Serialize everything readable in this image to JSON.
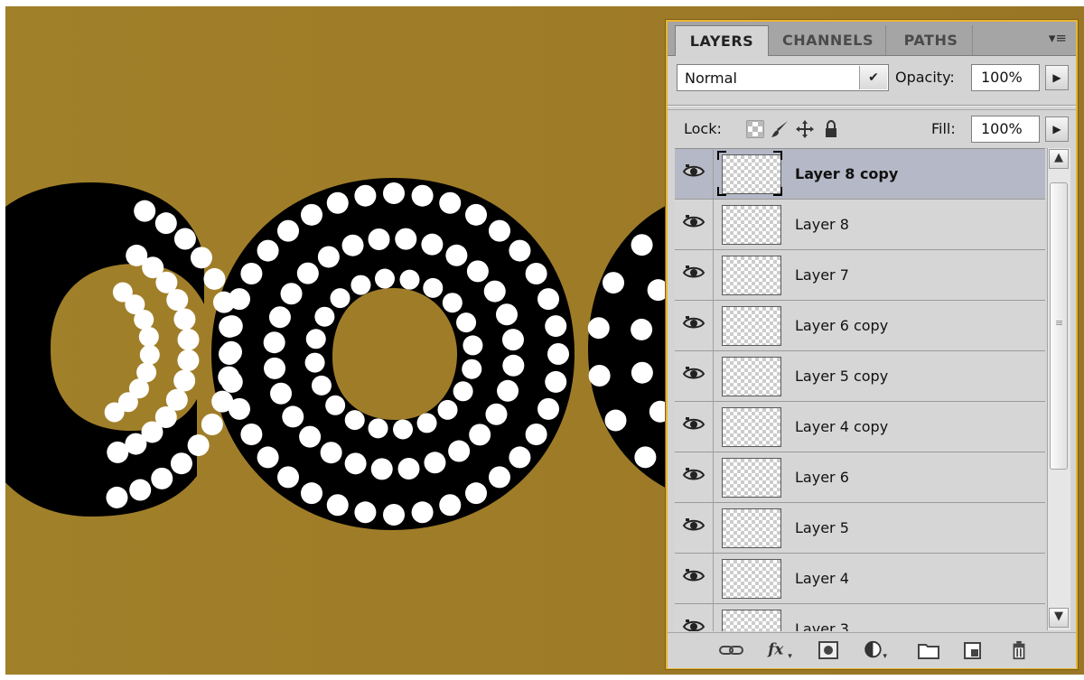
{
  "document": {
    "background_color": "#9e7b27",
    "letter_fill": "#000000",
    "dot_color": "#ffffff"
  },
  "layers_panel": {
    "tabs": [
      {
        "label": "LAYERS",
        "active": true
      },
      {
        "label": "CHANNELS",
        "active": false
      },
      {
        "label": "PATHS",
        "active": false
      }
    ],
    "blend_mode": "Normal",
    "opacity_label": "Opacity:",
    "opacity_value": "100%",
    "lock_label": "Lock:",
    "fill_label": "Fill:",
    "fill_value": "100%",
    "lock_icons": [
      "lock-transparent-icon",
      "lock-image-icon",
      "lock-position-icon",
      "lock-all-icon"
    ],
    "layers": [
      {
        "name": "Layer 8 copy",
        "visible": true,
        "selected": true
      },
      {
        "name": "Layer 8",
        "visible": true,
        "selected": false
      },
      {
        "name": "Layer 7",
        "visible": true,
        "selected": false
      },
      {
        "name": "Layer 6 copy",
        "visible": true,
        "selected": false
      },
      {
        "name": "Layer 5 copy",
        "visible": true,
        "selected": false
      },
      {
        "name": "Layer 4 copy",
        "visible": true,
        "selected": false
      },
      {
        "name": "Layer 6",
        "visible": true,
        "selected": false
      },
      {
        "name": "Layer 5",
        "visible": true,
        "selected": false
      },
      {
        "name": "Layer 4",
        "visible": true,
        "selected": false
      },
      {
        "name": "Layer 3",
        "visible": true,
        "selected": false
      }
    ],
    "footer_icons": [
      "link-layers-icon",
      "fx-icon",
      "add-mask-icon",
      "adjustment-layer-icon",
      "new-group-icon",
      "new-layer-icon",
      "trash-icon"
    ],
    "selection_color": "#b5b8c6",
    "panel_border_color": "#e9b431"
  }
}
